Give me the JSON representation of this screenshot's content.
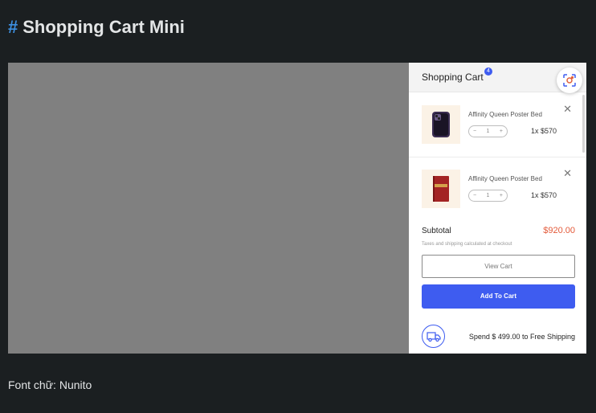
{
  "page": {
    "hash": "#",
    "title": "Shopping Cart Mini",
    "font_note": "Font chữ: Nunito"
  },
  "cart": {
    "title": "Shopping Cart",
    "count": "4",
    "items": [
      {
        "name": "Affinity Queen Poster Bed",
        "qty": "1",
        "price": "1x $570",
        "minus": "−",
        "plus": "+",
        "remove": "✕",
        "thumb_icon": "phone-icon"
      },
      {
        "name": "Affinity Queen Poster Bed",
        "qty": "1",
        "price": "1x $570",
        "minus": "−",
        "plus": "+",
        "remove": "✕",
        "thumb_icon": "book-icon"
      }
    ],
    "subtotal_label": "Subtotal",
    "subtotal_value": "$920.00",
    "tax_note": "Taxes and shipping calculated at checkout",
    "view_cart_label": "View Cart",
    "add_to_cart_label": "Add To Cart",
    "shipping_text": "Spend $ 499.00 to Free Shipping"
  },
  "colors": {
    "accent": "#3e5cf0",
    "price": "#e35a3a",
    "hash": "#3d8fe0"
  }
}
